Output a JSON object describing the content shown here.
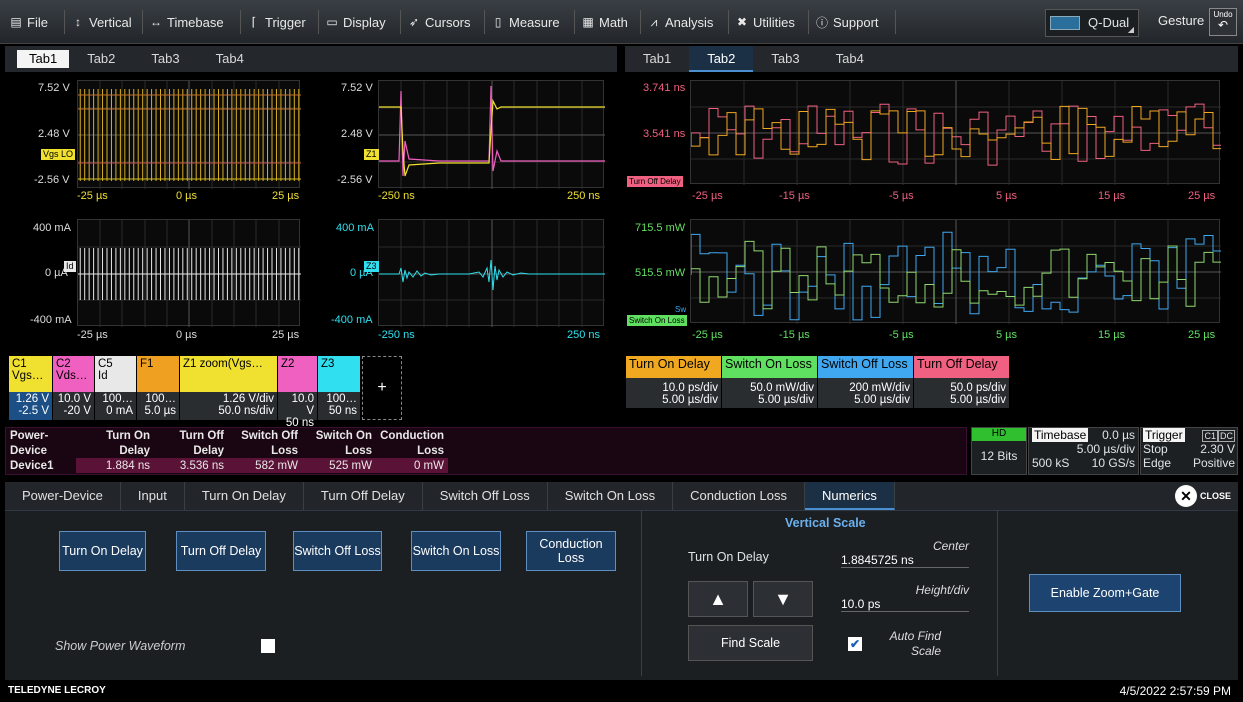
{
  "menu": [
    {
      "label": "File",
      "icon": "file-icon"
    },
    {
      "label": "Vertical",
      "icon": "vertical-arrows-icon"
    },
    {
      "label": "Timebase",
      "icon": "horizontal-arrows-icon"
    },
    {
      "label": "Trigger",
      "icon": "trigger-icon"
    },
    {
      "label": "Display",
      "icon": "display-icon"
    },
    {
      "label": "Cursors",
      "icon": "cursor-icon"
    },
    {
      "label": "Measure",
      "icon": "measure-icon"
    },
    {
      "label": "Math",
      "icon": "calculator-icon"
    },
    {
      "label": "Analysis",
      "icon": "analysis-chart-icon"
    },
    {
      "label": "Utilities",
      "icon": "tools-icon"
    },
    {
      "label": "Support",
      "icon": "info-icon"
    }
  ],
  "layout_label": "Q-Dual",
  "gesture_label": "Gesture",
  "undo_label": "Undo",
  "left_tabs": [
    "Tab1",
    "Tab2",
    "Tab3",
    "Tab4"
  ],
  "right_tabs": [
    "Tab1",
    "Tab2",
    "Tab3",
    "Tab4"
  ],
  "grid1": {
    "ytop": "7.52 V",
    "ymid": "2.48 V",
    "ybot": "-2.56 V",
    "x0": "-25 µs",
    "x1": "0 µs",
    "x2": "25 µs",
    "chip": "Vgs LO"
  },
  "grid2": {
    "ytop": "7.52 V",
    "ymid": "2.48 V",
    "ybot": "-2.56 V",
    "x0": "-250 ns",
    "x2": "250 ns",
    "chip": "Z1"
  },
  "grid3": {
    "ytop": "3.741 ns",
    "ymid": "3.541 ns",
    "chip": "Turn Off Delay",
    "ticks": [
      "-25 µs",
      "-15 µs",
      "-5 µs",
      "5 µs",
      "15 µs",
      "25 µs"
    ]
  },
  "grid4": {
    "ytop": "400 mA",
    "ymid": "0 µA",
    "ybot": "-400 mA",
    "x0": "-25 µs",
    "x1": "0 µs",
    "x2": "25 µs",
    "chip": "Id"
  },
  "grid5": {
    "ytop": "400 mA",
    "ymid": "0 µA",
    "ybot": "-400 mA",
    "x0": "-250 ns",
    "x2": "250 ns",
    "chip": "Z3"
  },
  "grid6": {
    "ytop": "715.5 mW",
    "ymid": "515.5 mW",
    "chip": "Switch On Loss",
    "chip2": "Sw",
    "ticks": [
      "-25 µs",
      "-15 µs",
      "-5 µs",
      "5 µs",
      "15 µs",
      "25 µs"
    ]
  },
  "channels": [
    {
      "name": "C1",
      "sub": "Vgs…",
      "v1": "1.26 V",
      "v2": "-2.5 V",
      "color": "#f0e030"
    },
    {
      "name": "C2",
      "sub": "Vds…",
      "v1": "10.0 V",
      "v2": "-20 V",
      "color": "#f060c0"
    },
    {
      "name": "C5",
      "sub": "Id",
      "v1": "100…",
      "v2": "0 mA",
      "color": "#e8e8e8"
    },
    {
      "name": "F1",
      "sub": "",
      "v1": "100…",
      "v2": "5.0 µs",
      "color": "#f0a020"
    },
    {
      "name": "Z1 zoom(Vgs…",
      "sub": "",
      "v1": "1.26 V/div",
      "v2": "50.0 ns/div",
      "color": "#f0e030"
    },
    {
      "name": "Z2",
      "sub": "",
      "v1": "10.0 V",
      "v2": "50 ns",
      "color": "#f060c0"
    },
    {
      "name": "Z3",
      "sub": "",
      "v1": "100…",
      "v2": "50 ns",
      "color": "#30e0f0"
    }
  ],
  "add_label": "+",
  "params": [
    {
      "name": "Turn On Delay",
      "v1": "10.0 ps/div",
      "v2": "5.00 µs/div",
      "color": "#f0a820"
    },
    {
      "name": "Switch On Loss",
      "v1": "50.0 mW/div",
      "v2": "5.00 µs/div",
      "color": "#60e060"
    },
    {
      "name": "Switch Off Loss",
      "v1": "200 mW/div",
      "v2": "5.00 µs/div",
      "color": "#40a8f0"
    },
    {
      "name": "Turn Off Delay",
      "v1": "50.0 ps/div",
      "v2": "5.00 µs/div",
      "color": "#f06080"
    }
  ],
  "power_table": {
    "headers1": [
      "Power-",
      "Turn On",
      "Turn Off",
      "Switch Off",
      "Switch On",
      "Conduction"
    ],
    "headers2": [
      "Device",
      "Delay",
      "Delay",
      "Loss",
      "Loss",
      "Loss"
    ],
    "row": [
      "Device1",
      "1.884 ns",
      "3.536 ns",
      "582 mW",
      "525 mW",
      "0 mW"
    ]
  },
  "status": {
    "hd": "HD",
    "bits": "12 Bits",
    "timebase_label": "Timebase",
    "timebase_delay": "0.0 µs",
    "tdiv": "5.00 µs/div",
    "samples": "500 kS",
    "rate": "10 GS/s",
    "trigger_label": "Trigger",
    "trig_src": "C1",
    "trig_coupling": "DC",
    "trig_mode": "Stop",
    "trig_level": "2.30 V",
    "trig_type": "Edge",
    "trig_slope": "Positive"
  },
  "bottom_tabs": [
    "Power-Device",
    "Input",
    "Turn On Delay",
    "Turn Off Delay",
    "Switch Off Loss",
    "Switch On Loss",
    "Conduction Loss",
    "Numerics"
  ],
  "close_label": "CLOSE",
  "buttons": [
    "Turn On Delay",
    "Turn Off Delay",
    "Switch Off Loss",
    "Switch On Loss",
    "Conduction Loss"
  ],
  "show_power": "Show Power Waveform",
  "vscale": {
    "title": "Vertical Scale",
    "param": "Turn On Delay",
    "center_label": "Center",
    "center_value": "1.8845725 ns",
    "height_label": "Height/div",
    "height_value": "10.0 ps",
    "find_scale": "Find Scale",
    "auto_find": "Auto Find Scale"
  },
  "enable_zoom": "Enable Zoom+Gate",
  "footer": {
    "brand": "TELEDYNE LECROY",
    "datetime": "4/5/2022 2:57:59 PM"
  }
}
